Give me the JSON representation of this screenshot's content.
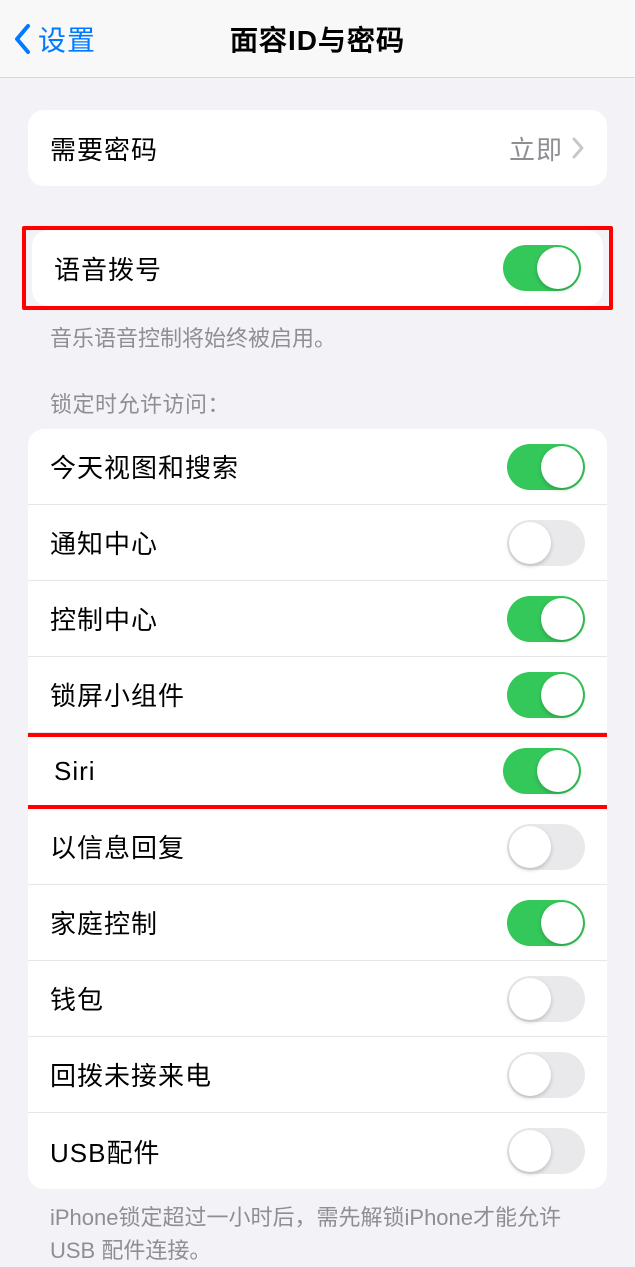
{
  "header": {
    "back_label": "设置",
    "title": "面容ID与密码"
  },
  "require_passcode": {
    "label": "需要密码",
    "value": "立即"
  },
  "voice_dial": {
    "label": "语音拨号",
    "footer": "音乐语音控制将始终被启用。"
  },
  "locked_access": {
    "section_header": "锁定时允许访问：",
    "items": [
      {
        "label": "今天视图和搜索",
        "on": true
      },
      {
        "label": "通知中心",
        "on": false
      },
      {
        "label": "控制中心",
        "on": true
      },
      {
        "label": "锁屏小组件",
        "on": true
      },
      {
        "label": "Siri",
        "on": true
      },
      {
        "label": "以信息回复",
        "on": false
      },
      {
        "label": "家庭控制",
        "on": true
      },
      {
        "label": "钱包",
        "on": false
      },
      {
        "label": "回拨未接来电",
        "on": false
      },
      {
        "label": "USB配件",
        "on": false
      }
    ],
    "footer": "iPhone锁定超过一小时后，需先解锁iPhone才能允许USB 配件连接。"
  }
}
